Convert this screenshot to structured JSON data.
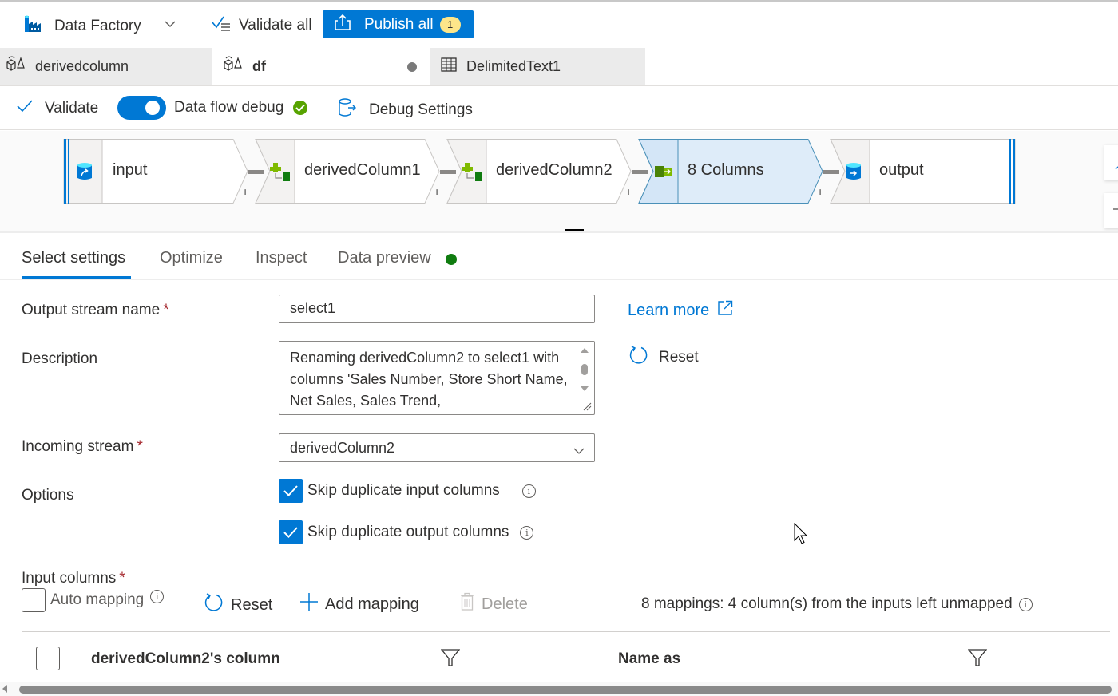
{
  "toolbar": {
    "factory_label": "Data Factory",
    "validate_all_label": "Validate all",
    "publish_all_label": "Publish all",
    "publish_count": "1"
  },
  "doc_tabs": [
    {
      "label": "derivedcolumn",
      "icon": "dataflow-icon",
      "active": false
    },
    {
      "label": "df",
      "icon": "dataflow-icon",
      "active": true,
      "unsaved": true
    },
    {
      "label": "DelimitedText1",
      "icon": "table-icon",
      "active": false
    }
  ],
  "subbar": {
    "validate_label": "Validate",
    "debug_label": "Data flow debug",
    "debug_on": true,
    "debug_settings_label": "Debug Settings"
  },
  "pipeline": {
    "nodes": [
      {
        "label": "input",
        "type": "source"
      },
      {
        "label": "derivedColumn1",
        "type": "derived-column"
      },
      {
        "label": "derivedColumn2",
        "type": "derived-column"
      },
      {
        "label": "8 Columns",
        "type": "select",
        "selected": true
      },
      {
        "label": "output",
        "type": "sink"
      }
    ],
    "add_symbol": "+"
  },
  "settings_tabs": [
    {
      "label": "Select settings",
      "active": true
    },
    {
      "label": "Optimize",
      "active": false
    },
    {
      "label": "Inspect",
      "active": false
    },
    {
      "label": "Data preview",
      "active": false,
      "status": "ready"
    }
  ],
  "form": {
    "output_stream_label": "Output stream name",
    "output_stream_value": "select1",
    "required_marker": "*",
    "learn_more_label": "Learn more",
    "description_label": "Description",
    "description_value": "Renaming derivedColumn2 to select1 with columns 'Sales Number, Store Short Name, Net Sales, Sales Trend,",
    "reset_label": "Reset",
    "incoming_stream_label": "Incoming stream",
    "incoming_stream_value": "derivedColumn2",
    "options_label": "Options",
    "options": [
      {
        "label": "Skip duplicate input columns",
        "checked": true
      },
      {
        "label": "Skip duplicate output columns",
        "checked": true
      }
    ]
  },
  "input_columns": {
    "label": "Input columns",
    "auto_mapping_label": "Auto mapping",
    "auto_mapping_checked": false,
    "reset_label": "Reset",
    "add_mapping_label": "Add mapping",
    "delete_label": "Delete",
    "summary": "8 mappings: 4 column(s) from the inputs left unmapped",
    "columns": [
      "derivedColumn2's column",
      "Name as"
    ]
  },
  "colors": {
    "accent": "#0078d4",
    "selected_node_bg": "#deecf9",
    "status_green": "#107c10",
    "debug_green": "#57a300",
    "badge": "#fde68a",
    "required": "#a4262c"
  }
}
